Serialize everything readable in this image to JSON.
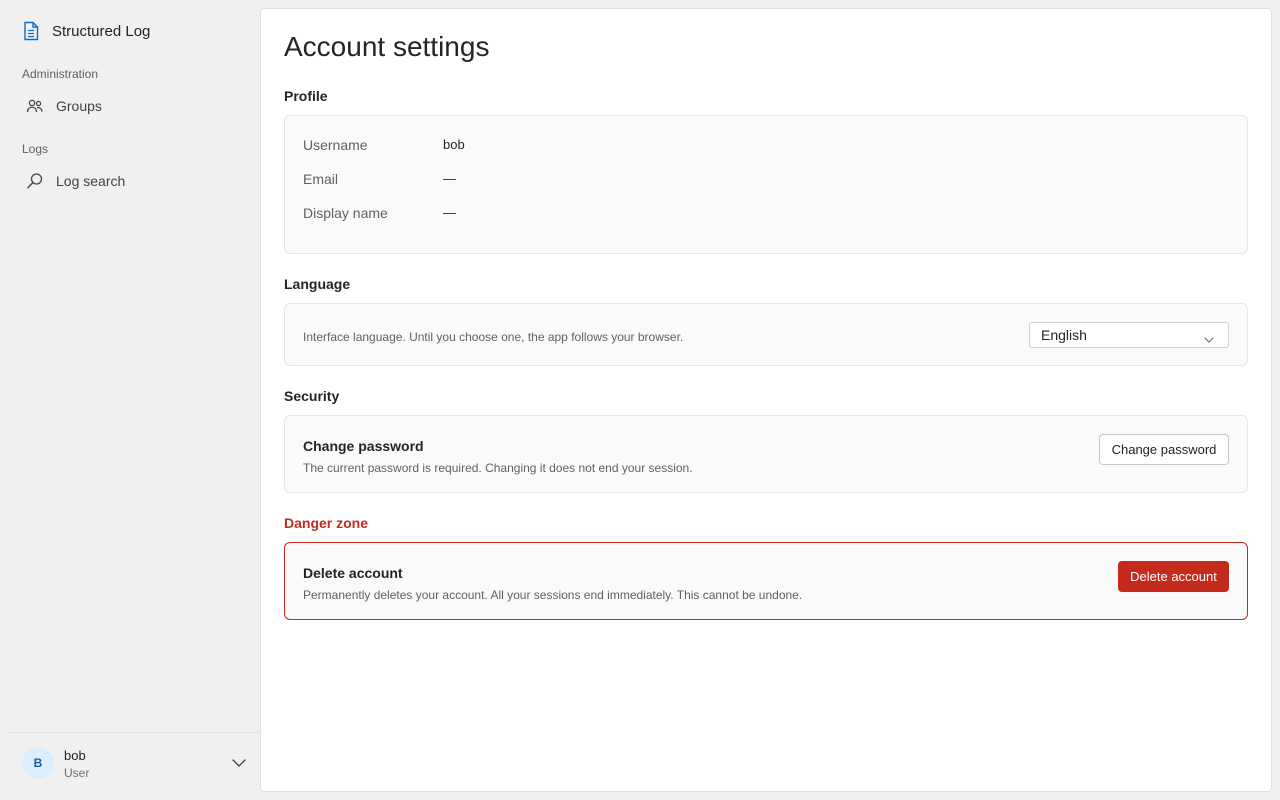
{
  "app": {
    "name": "Structured Log",
    "icon": "document-icon"
  },
  "sidebar": {
    "sections": [
      {
        "label": "Administration",
        "items": [
          {
            "label": "Groups",
            "icon": "people-icon"
          }
        ]
      },
      {
        "label": "Logs",
        "items": [
          {
            "label": "Log search",
            "icon": "search-icon"
          }
        ]
      }
    ],
    "user": {
      "initial": "B",
      "name": "bob",
      "role": "User"
    }
  },
  "page": {
    "title": "Account settings"
  },
  "profile": {
    "title": "Profile",
    "rows": [
      {
        "label": "Username",
        "value": "bob"
      },
      {
        "label": "Email",
        "value": "—"
      },
      {
        "label": "Display name",
        "value": "—"
      }
    ]
  },
  "language": {
    "title": "Language",
    "description": "Interface language. Until you choose one, the app follows your browser.",
    "selected": "English"
  },
  "security": {
    "title": "Security",
    "heading": "Change password",
    "description": "The current password is required. Changing it does not end your session.",
    "button_label": "Change password"
  },
  "danger": {
    "title": "Danger zone",
    "heading": "Delete account",
    "description": "Permanently deletes your account. All your sessions end immediately. This cannot be undone.",
    "button_label": "Delete account"
  },
  "colors": {
    "accent": "#0f6cbd",
    "danger": "#c42b1c"
  }
}
